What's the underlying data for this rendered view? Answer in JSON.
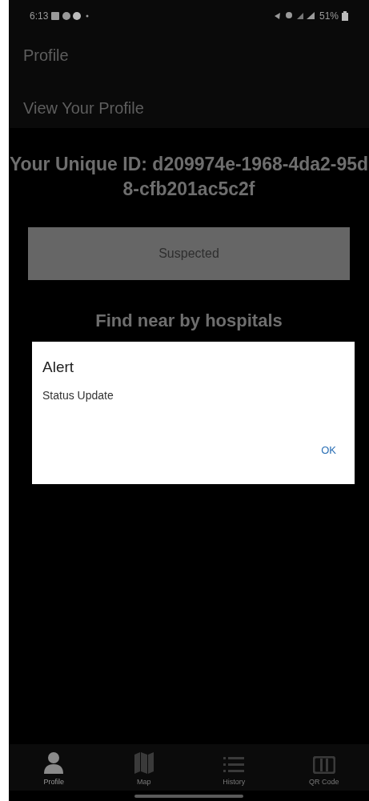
{
  "status_bar": {
    "time": "6:13",
    "battery": "51%"
  },
  "header": {
    "title": "Profile",
    "subtitle": "View Your Profile"
  },
  "unique_id": "Your Unique ID: d209974e-1968-4da2-95d8-cfb201ac5c2f",
  "status_button": "Suspected",
  "section_heading": "Find near by hospitals",
  "dialog": {
    "title": "Alert",
    "message": "Status Update",
    "button": "OK"
  },
  "tabs": [
    {
      "label": "Profile",
      "selected": true
    },
    {
      "label": "Map",
      "selected": false
    },
    {
      "label": "History",
      "selected": false
    },
    {
      "label": "QR Code",
      "selected": false
    }
  ]
}
